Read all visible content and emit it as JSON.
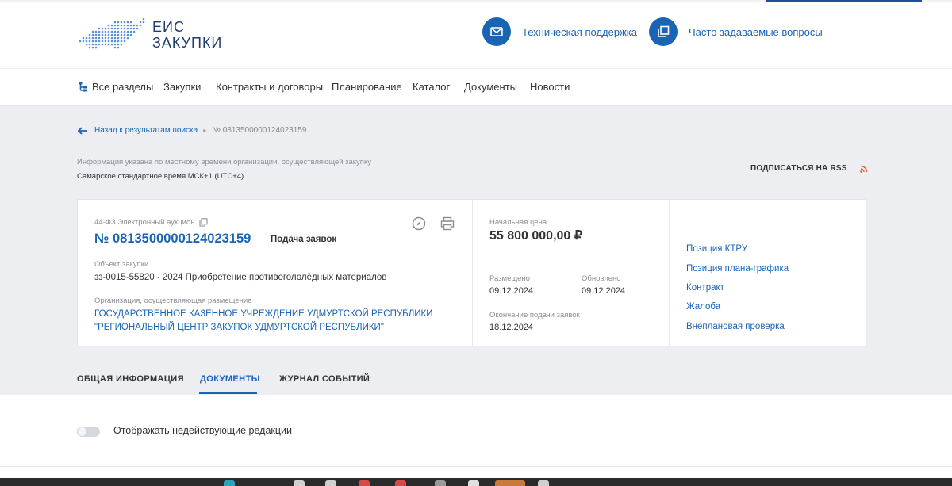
{
  "header": {
    "logo_line1": "ЕИС",
    "logo_line2": "ЗАКУПКИ",
    "support_label": "Техническая поддержка",
    "faq_label": "Часто задаваемые вопросы",
    "support_icon": "mail-icon",
    "faq_icon": "windows-icon"
  },
  "nav": {
    "items": [
      "Все разделы",
      "Закупки",
      "Контракты и договоры",
      "Планирование",
      "Каталог",
      "Документы",
      "Новости"
    ]
  },
  "breadcrumb": {
    "back_label": "Назад к результатам поиска",
    "current": "№ 0813500000124023159"
  },
  "timezone": {
    "info": "Информация указана по местному времени организации, осуществляющей закупку",
    "value": "Самарское стандартное время МСК+1 (UTC+4)"
  },
  "rss_label": "ПОДПИСАТЬСЯ НА RSS",
  "card": {
    "law": "44-ФЗ Электронный аукцион",
    "number": "№ 0813500000124023159",
    "stage": "Подача заявок",
    "object_label": "Объект закупки",
    "object_value": "зз-0015-55820 - 2024 Приобретение противогололёдных материалов",
    "org_label": "Организация, осуществляющая размещение",
    "org_line1": "ГОСУДАРСТВЕННОЕ КАЗЕННОЕ УЧРЕЖДЕНИЕ УДМУРТСКОЙ РЕСПУБЛИКИ",
    "org_line2": "\"РЕГИОНАЛЬНЫЙ ЦЕНТР ЗАКУПОК УДМУРТСКОЙ РЕСПУБЛИКИ\"",
    "price_label": "Начальная цена",
    "price_value": "55 800 000,00 ₽",
    "posted_label": "Размещено",
    "posted_value": "09.12.2024",
    "updated_label": "Обновлено",
    "updated_value": "09.12.2024",
    "deadline_label": "Окончание подачи заявок",
    "deadline_value": "18.12.2024",
    "links": [
      "Позиция КТРУ",
      "Позиция плана-графика",
      "Контракт",
      "Жалоба",
      "Внеплановая проверка"
    ]
  },
  "tabs": [
    "ОБЩАЯ ИНФОРМАЦИЯ",
    "ДОКУМЕНТЫ",
    "ЖУРНАЛ СОБЫТИЙ"
  ],
  "active_tab": "ДОКУМЕНТЫ",
  "toggle": {
    "label": "Отображать недействующие редакции",
    "on": false
  },
  "colors": {
    "accent": "#1a64b5",
    "grey_bg": "#eceef1",
    "rss": "#e8612c"
  }
}
